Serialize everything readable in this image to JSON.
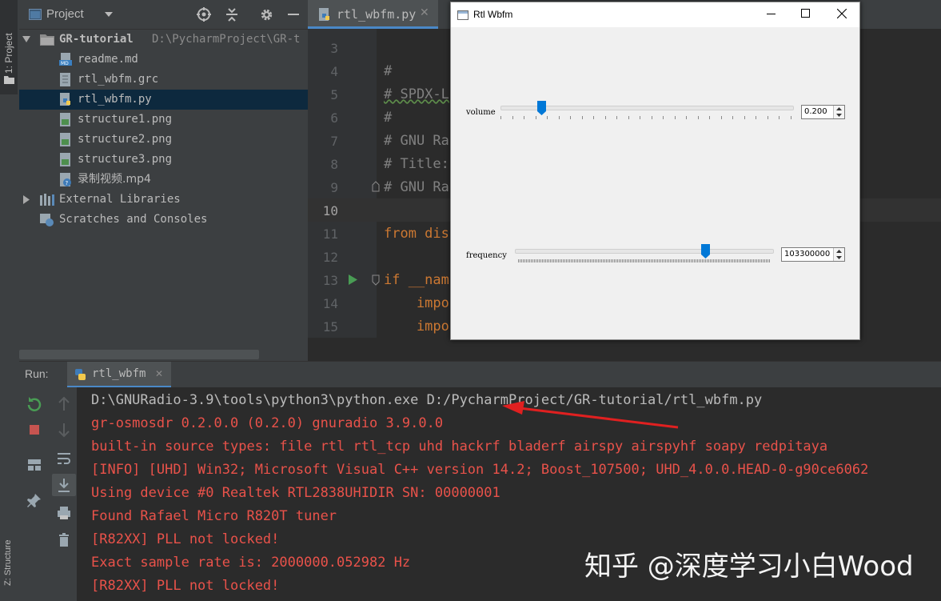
{
  "left_strip": {
    "project_label": "1: Project",
    "structure_label": "Z: Structure"
  },
  "project_panel": {
    "title": "Project",
    "tree": [
      {
        "name": "GR-tutorial",
        "path": "D:\\PycharmProject\\GR-t",
        "type": "folder"
      },
      {
        "name": "readme.md",
        "icon": "md-file-icon"
      },
      {
        "name": "rtl_wbfm.grc",
        "icon": "grc-file-icon"
      },
      {
        "name": "rtl_wbfm.py",
        "icon": "python-file-icon",
        "selected": true
      },
      {
        "name": "structure1.png",
        "icon": "image-file-icon"
      },
      {
        "name": "structure2.png",
        "icon": "image-file-icon"
      },
      {
        "name": "structure3.png",
        "icon": "image-file-icon"
      },
      {
        "name": "录制视频.mp4",
        "icon": "unknown-file-icon"
      },
      {
        "name": "External Libraries",
        "icon": "library-icon"
      },
      {
        "name": "Scratches and Consoles",
        "icon": "scratches-icon"
      }
    ]
  },
  "editor": {
    "tab_label": "rtl_wbfm.py",
    "line_numbers": [
      "3",
      "4",
      "5",
      "6",
      "7",
      "8",
      "9",
      "10",
      "11",
      "12",
      "13",
      "14",
      "15"
    ],
    "code_lines": [
      "",
      "#",
      "# SPDX-L",
      "#",
      "# GNU Ra",
      "# Title:",
      "# GNU Ra",
      "",
      "from dis",
      "",
      "if __nam",
      "    impo",
      "    impo"
    ]
  },
  "qt_window": {
    "title": "Rtl Wbfm",
    "volume": {
      "label": "volume",
      "value": "0.200",
      "position_fraction": 0.14
    },
    "frequency": {
      "label": "frequency",
      "value": "103300000",
      "position_fraction": 0.74
    }
  },
  "run": {
    "label": "Run:",
    "tab_label": "rtl_wbfm",
    "command": "D:\\GNURadio-3.9\\tools\\python3\\python.exe D:/PycharmProject/GR-tutorial/rtl_wbfm.py",
    "output": [
      "gr-osmosdr 0.2.0.0 (0.2.0) gnuradio 3.9.0.0",
      "built-in source types: file rtl rtl_tcp uhd hackrf bladerf airspy airspyhf soapy redpitaya",
      "[INFO] [UHD] Win32; Microsoft Visual C++ version 14.2; Boost_107500; UHD_4.0.0.HEAD-0-g90ce6062",
      "Using device #0 Realtek RTL2838UHIDIR SN: 00000001",
      "Found Rafael Micro R820T tuner",
      "[R82XX] PLL not locked!",
      "Exact sample rate is: 2000000.052982 Hz",
      "[R82XX] PLL not locked!"
    ]
  },
  "watermark": "知乎 @深度学习小白Wood",
  "colors": {
    "output_red": "#e9524a",
    "command_gray": "#bbbbbb",
    "comment_gray": "#808080",
    "keyword_orange": "#cc7832",
    "slider_blue": "#0078d7",
    "selection": "#0d293e"
  }
}
